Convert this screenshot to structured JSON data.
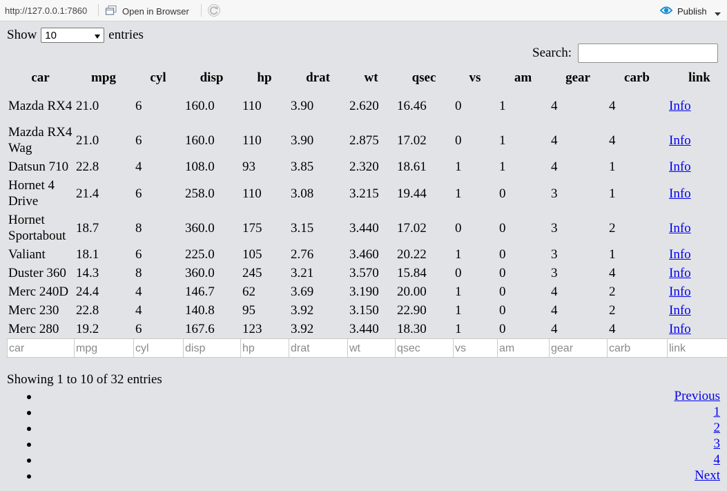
{
  "toolbar": {
    "url": "http://127.0.0.1:7860",
    "open_in_browser": "Open in Browser",
    "publish": "Publish"
  },
  "length": {
    "show_label": "Show",
    "selected": "10",
    "entries_label": "entries"
  },
  "search": {
    "label": "Search:",
    "value": ""
  },
  "table": {
    "columns": [
      "car",
      "mpg",
      "cyl",
      "disp",
      "hp",
      "drat",
      "wt",
      "qsec",
      "vs",
      "am",
      "gear",
      "carb",
      "link"
    ],
    "rows": [
      [
        "Mazda RX4",
        "21.0",
        "6",
        "160.0",
        "110",
        "3.90",
        "2.620",
        "16.46",
        "0",
        "1",
        "4",
        "4",
        "Info"
      ],
      [
        "Mazda RX4 Wag",
        "21.0",
        "6",
        "160.0",
        "110",
        "3.90",
        "2.875",
        "17.02",
        "0",
        "1",
        "4",
        "4",
        "Info"
      ],
      [
        "Datsun 710",
        "22.8",
        "4",
        "108.0",
        "93",
        "3.85",
        "2.320",
        "18.61",
        "1",
        "1",
        "4",
        "1",
        "Info"
      ],
      [
        "Hornet 4 Drive",
        "21.4",
        "6",
        "258.0",
        "110",
        "3.08",
        "3.215",
        "19.44",
        "1",
        "0",
        "3",
        "1",
        "Info"
      ],
      [
        "Hornet Sportabout",
        "18.7",
        "8",
        "360.0",
        "175",
        "3.15",
        "3.440",
        "17.02",
        "0",
        "0",
        "3",
        "2",
        "Info"
      ],
      [
        "Valiant",
        "18.1",
        "6",
        "225.0",
        "105",
        "2.76",
        "3.460",
        "20.22",
        "1",
        "0",
        "3",
        "1",
        "Info"
      ],
      [
        "Duster 360",
        "14.3",
        "8",
        "360.0",
        "245",
        "3.21",
        "3.570",
        "15.84",
        "0",
        "0",
        "3",
        "4",
        "Info"
      ],
      [
        "Merc 240D",
        "24.4",
        "4",
        "146.7",
        "62",
        "3.69",
        "3.190",
        "20.00",
        "1",
        "0",
        "4",
        "2",
        "Info"
      ],
      [
        "Merc 230",
        "22.8",
        "4",
        "140.8",
        "95",
        "3.92",
        "3.150",
        "22.90",
        "1",
        "0",
        "4",
        "2",
        "Info"
      ],
      [
        "Merc 280",
        "19.2",
        "6",
        "167.6",
        "123",
        "3.92",
        "3.440",
        "18.30",
        "1",
        "0",
        "4",
        "4",
        "Info"
      ]
    ],
    "filter_placeholders": [
      "car",
      "mpg",
      "cyl",
      "disp",
      "hp",
      "drat",
      "wt",
      "qsec",
      "vs",
      "am",
      "gear",
      "carb",
      "link"
    ]
  },
  "info": "Showing 1 to 10 of 32 entries",
  "pagination": [
    "Previous",
    "1",
    "2",
    "3",
    "4",
    "Next"
  ],
  "colors": {
    "background": "#e2e3e6",
    "link": "#0000ee",
    "publish_icon": "#1a8fd6"
  },
  "icons": {
    "open_in_browser": "browser-window-icon",
    "refresh": "refresh-icon",
    "publish": "publish-icon",
    "dropdown": "caret-down-icon"
  }
}
